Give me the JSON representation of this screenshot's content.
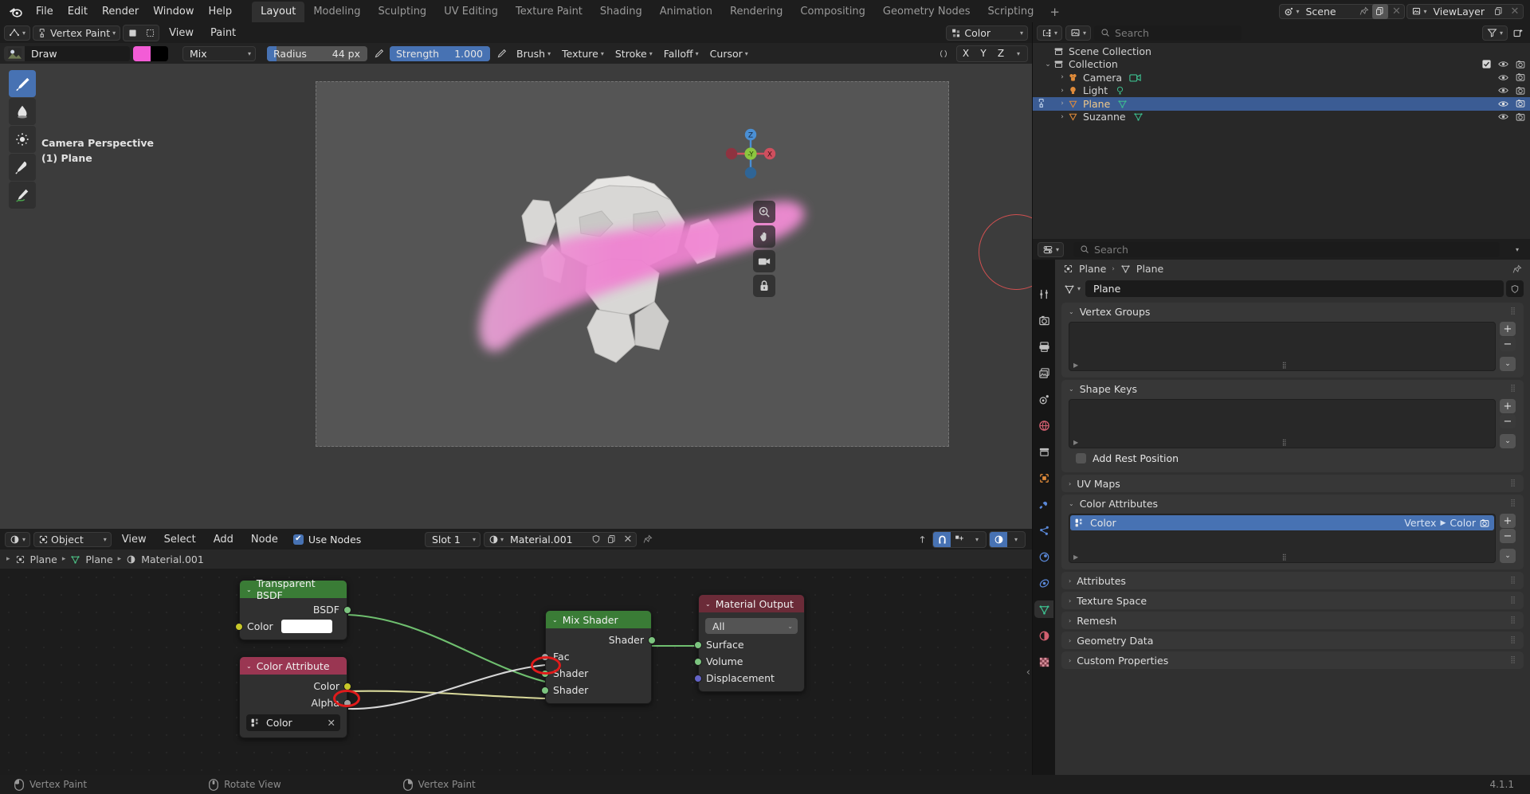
{
  "app": {
    "logo": "blender-logo",
    "version": "4.1.1"
  },
  "topbar": {
    "menus": [
      "File",
      "Edit",
      "Render",
      "Window",
      "Help"
    ],
    "workspaces": [
      {
        "label": "Layout",
        "active": true
      },
      {
        "label": "Modeling",
        "active": false
      },
      {
        "label": "Sculpting",
        "active": false
      },
      {
        "label": "UV Editing",
        "active": false
      },
      {
        "label": "Texture Paint",
        "active": false
      },
      {
        "label": "Shading",
        "active": false
      },
      {
        "label": "Animation",
        "active": false
      },
      {
        "label": "Rendering",
        "active": false
      },
      {
        "label": "Compositing",
        "active": false
      },
      {
        "label": "Geometry Nodes",
        "active": false
      },
      {
        "label": "Scripting",
        "active": false
      }
    ],
    "add_workspace": "+",
    "scene_name": "Scene",
    "view_layer_name": "ViewLayer"
  },
  "viewport_header": {
    "mode": "Vertex Paint",
    "menus": [
      "View",
      "Paint"
    ],
    "paint_mask_label": "Color",
    "transform_axes": [
      "X",
      "Y",
      "Z"
    ]
  },
  "tool_settings": {
    "brush_name": "Draw",
    "primary_color": "#f35cd6",
    "secondary_color": "#000000",
    "blend_mode": "Mix",
    "radius_label": "Radius",
    "radius_value": "44 px",
    "strength_label": "Strength",
    "strength_value": "1.000",
    "popovers": [
      "Brush",
      "Texture",
      "Stroke",
      "Falloff",
      "Cursor"
    ]
  },
  "viewport": {
    "view_name": "Camera Perspective",
    "active_object": "(1) Plane",
    "gizmo_axes": {
      "z": "Z",
      "x": "X",
      "y": "-Y"
    },
    "brush_cursor_color": "#d05050",
    "tools": [
      {
        "name": "draw-brush-tool",
        "active": true
      },
      {
        "name": "blur-tool",
        "active": false
      },
      {
        "name": "average-tool",
        "active": false
      },
      {
        "name": "smear-tool",
        "active": false
      },
      {
        "name": "annotate-tool",
        "active": false
      }
    ]
  },
  "shader_editor": {
    "editor_type": "shader-editor",
    "shader_type": "Object",
    "menus": [
      "View",
      "Select",
      "Add",
      "Node"
    ],
    "use_nodes_label": "Use Nodes",
    "use_nodes_checked": true,
    "slot": "Slot 1",
    "material": "Material.001",
    "breadcrumb": [
      "Plane",
      "Plane",
      "Material.001"
    ],
    "nodes": [
      {
        "name": "transparent-bsdf-node",
        "title": "Transparent BSDF",
        "header_color": "#3a7c36",
        "outputs": [
          {
            "label": "BSDF",
            "color": "green"
          }
        ],
        "inputs": [
          {
            "label": "Color",
            "color": "yellow",
            "value_swatch": "#ffffff"
          }
        ]
      },
      {
        "name": "color-attribute-node",
        "title": "Color Attribute",
        "header_color": "#9a3652",
        "outputs": [
          {
            "label": "Color",
            "color": "yellow"
          },
          {
            "label": "Alpha",
            "color": "grey"
          }
        ],
        "attribute_field": "Color"
      },
      {
        "name": "mix-shader-node",
        "title": "Mix Shader",
        "header_color": "#3a7c36",
        "outputs": [
          {
            "label": "Shader",
            "color": "green"
          }
        ],
        "inputs": [
          {
            "label": "Fac",
            "color": "grey"
          },
          {
            "label": "Shader",
            "color": "green"
          },
          {
            "label": "Shader",
            "color": "green"
          }
        ]
      },
      {
        "name": "material-output-node",
        "title": "Material Output",
        "header_color": "#6b2b38",
        "target": "All",
        "inputs": [
          {
            "label": "Surface",
            "color": "green"
          },
          {
            "label": "Volume",
            "color": "green"
          },
          {
            "label": "Displacement",
            "color": "blue"
          }
        ]
      }
    ],
    "annotations": {
      "highlight_color": "#e01b1b"
    }
  },
  "outliner": {
    "search_placeholder": "Search",
    "rows": [
      {
        "label": "Scene Collection",
        "indent": 0,
        "icon": "collection-icon",
        "selected": false,
        "has_disclosure": false
      },
      {
        "label": "Collection",
        "indent": 1,
        "icon": "collection-icon",
        "selected": false,
        "has_disclosure": true,
        "checkbox": true
      },
      {
        "label": "Camera",
        "indent": 2,
        "icon": "camera-object-icon",
        "selected": false,
        "has_disclosure": true,
        "data_icon": "camera-data-icon"
      },
      {
        "label": "Light",
        "indent": 2,
        "icon": "light-object-icon",
        "selected": false,
        "has_disclosure": true,
        "data_icon": "light-data-icon"
      },
      {
        "label": "Plane",
        "indent": 2,
        "icon": "mesh-object-icon",
        "selected": true,
        "has_disclosure": true,
        "data_icon": "mesh-data-icon"
      },
      {
        "label": "Suzanne",
        "indent": 2,
        "icon": "mesh-object-icon",
        "selected": false,
        "has_disclosure": true,
        "data_icon": "mesh-data-icon"
      }
    ]
  },
  "properties": {
    "search_placeholder": "Search",
    "breadcrumb": [
      "Plane",
      "Plane"
    ],
    "datablock_name": "Plane",
    "panels": [
      {
        "title": "Vertex Groups",
        "open": true,
        "type": "list"
      },
      {
        "title": "Shape Keys",
        "open": true,
        "type": "list",
        "extra_checkbox": "Add Rest Position"
      },
      {
        "title": "UV Maps",
        "open": false
      },
      {
        "title": "Color Attributes",
        "open": true,
        "type": "attr-list"
      },
      {
        "title": "Attributes",
        "open": false
      },
      {
        "title": "Texture Space",
        "open": false
      },
      {
        "title": "Remesh",
        "open": false
      },
      {
        "title": "Geometry Data",
        "open": false
      },
      {
        "title": "Custom Properties",
        "open": false
      }
    ],
    "color_attribute": {
      "name": "Color",
      "domain": "Vertex",
      "data_type": "Color",
      "active_render": true
    },
    "add_rest_position": "Add Rest Position"
  },
  "statusbar": {
    "items": [
      {
        "icon": "mouse-left-icon",
        "label": "Vertex Paint"
      },
      {
        "icon": "mouse-middle-icon",
        "label": "Rotate View"
      },
      {
        "icon": "mouse-right-icon",
        "label": "Vertex Paint"
      }
    ],
    "version": "4.1.1"
  }
}
